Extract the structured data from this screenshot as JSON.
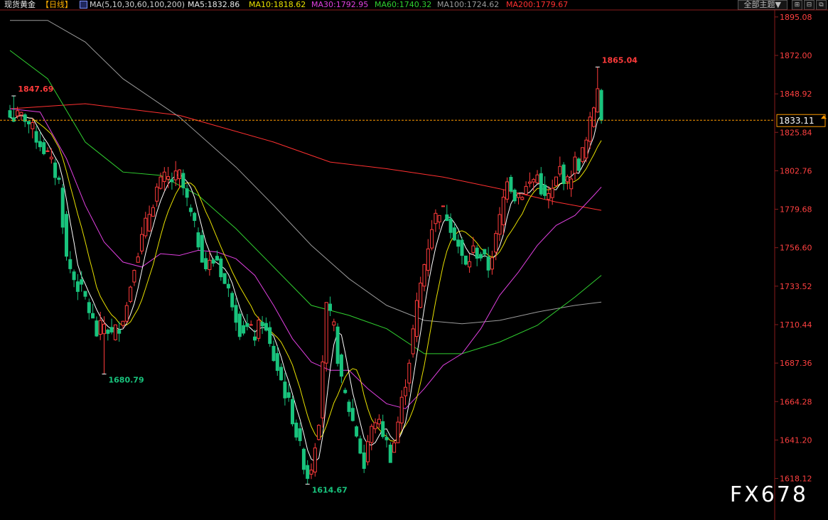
{
  "header": {
    "instrument": "现货黄金",
    "period": "【日线】",
    "ma_params": "MA(5,10,30,60,100,200)",
    "ma5": "MA5:1832.86",
    "ma10": "MA10:1818.62",
    "ma30": "MA30:1792.95",
    "ma60": "MA60:1740.32",
    "ma100": "MA100:1724.62",
    "ma200": "MA200:1779.67"
  },
  "toolbar": {
    "theme_label": "全部主题▼",
    "grid_icon": "⊞",
    "split_icon": "⊟",
    "window_icon": "⧉"
  },
  "watermark": "FX678",
  "colors": {
    "up": "#ff3b3b",
    "down": "#19c37d",
    "ma5": "#ffffff",
    "ma10": "#e8e000",
    "ma30": "#e040e0",
    "ma60": "#30d030",
    "ma100": "#9a9a9a",
    "ma200": "#ff3030",
    "axis_text": "#ff4040",
    "current_price": "#ff9a00"
  },
  "chart_data": {
    "type": "candlestick",
    "title": "",
    "y_ticks": [
      "1895.08",
      "1872.00",
      "1848.92",
      "1825.84",
      "1802.76",
      "1779.68",
      "1756.60",
      "1733.52",
      "1710.44",
      "1687.36",
      "1664.28",
      "1641.20",
      "1618.12"
    ],
    "ylim": [
      1603,
      1898
    ],
    "current_price": 1833.11,
    "current_price_label": "1833.11",
    "annotations": [
      {
        "label": "1847.69",
        "value": 1847.69,
        "kind": "high"
      },
      {
        "label": "1680.79",
        "value": 1680.79,
        "kind": "low"
      },
      {
        "label": "1614.67",
        "value": 1614.67,
        "kind": "low"
      },
      {
        "label": "1865.04",
        "value": 1865.04,
        "kind": "high"
      }
    ],
    "anchors": [
      [
        0,
        1835
      ],
      [
        4,
        1835
      ],
      [
        7,
        1823
      ],
      [
        10,
        1812
      ],
      [
        13,
        1796
      ],
      [
        15,
        1750
      ],
      [
        17,
        1738
      ],
      [
        20,
        1726
      ],
      [
        23,
        1705
      ],
      [
        25,
        1711
      ],
      [
        27,
        1704
      ],
      [
        29,
        1710
      ],
      [
        31,
        1722
      ],
      [
        33,
        1748
      ],
      [
        35,
        1762
      ],
      [
        37,
        1778
      ],
      [
        39,
        1792
      ],
      [
        41,
        1798
      ],
      [
        43,
        1797
      ],
      [
        45,
        1800
      ],
      [
        47,
        1784
      ],
      [
        49,
        1768
      ],
      [
        52,
        1745
      ],
      [
        55,
        1750
      ],
      [
        57,
        1735
      ],
      [
        59,
        1725
      ],
      [
        61,
        1708
      ],
      [
        63,
        1708
      ],
      [
        65,
        1704
      ],
      [
        67,
        1713
      ],
      [
        69,
        1697
      ],
      [
        71,
        1684
      ],
      [
        73,
        1670
      ],
      [
        75,
        1655
      ],
      [
        77,
        1636
      ],
      [
        79,
        1620
      ],
      [
        80,
        1626
      ],
      [
        82,
        1655
      ],
      [
        83,
        1690
      ],
      [
        84,
        1720
      ],
      [
        86,
        1708
      ],
      [
        88,
        1675
      ],
      [
        90,
        1660
      ],
      [
        92,
        1645
      ],
      [
        94,
        1625
      ],
      [
        95,
        1640
      ],
      [
        97,
        1654
      ],
      [
        99,
        1646
      ],
      [
        101,
        1632
      ],
      [
        102,
        1640
      ],
      [
        104,
        1664
      ],
      [
        106,
        1690
      ],
      [
        108,
        1722
      ],
      [
        110,
        1747
      ],
      [
        112,
        1770
      ],
      [
        114,
        1780
      ],
      [
        116,
        1776
      ],
      [
        118,
        1765
      ],
      [
        120,
        1750
      ],
      [
        121,
        1745
      ],
      [
        123,
        1755
      ],
      [
        125,
        1752
      ],
      [
        127,
        1745
      ],
      [
        129,
        1762
      ],
      [
        131,
        1786
      ],
      [
        132,
        1800
      ],
      [
        134,
        1788
      ],
      [
        136,
        1790
      ],
      [
        138,
        1795
      ],
      [
        140,
        1800
      ],
      [
        142,
        1785
      ],
      [
        144,
        1790
      ],
      [
        146,
        1804
      ],
      [
        148,
        1795
      ],
      [
        150,
        1808
      ],
      [
        151,
        1807
      ],
      [
        153,
        1820
      ],
      [
        155,
        1842
      ],
      [
        156,
        1848
      ],
      [
        157,
        1833
      ]
    ],
    "ma_lines": [
      {
        "name": "MA200",
        "values": [
          [
            0,
            1840
          ],
          [
            20,
            1843
          ],
          [
            45,
            1836
          ],
          [
            70,
            1820
          ],
          [
            85,
            1808
          ],
          [
            100,
            1804
          ],
          [
            115,
            1799
          ],
          [
            130,
            1792
          ],
          [
            145,
            1784
          ],
          [
            157,
            1779
          ]
        ]
      },
      {
        "name": "MA100",
        "values": [
          [
            0,
            1893
          ],
          [
            10,
            1893
          ],
          [
            20,
            1880
          ],
          [
            30,
            1858
          ],
          [
            45,
            1835
          ],
          [
            60,
            1805
          ],
          [
            70,
            1782
          ],
          [
            80,
            1758
          ],
          [
            90,
            1738
          ],
          [
            100,
            1722
          ],
          [
            110,
            1713
          ],
          [
            120,
            1711
          ],
          [
            130,
            1713
          ],
          [
            140,
            1718
          ],
          [
            150,
            1722
          ],
          [
            157,
            1724
          ]
        ]
      },
      {
        "name": "MA60",
        "values": [
          [
            0,
            1875
          ],
          [
            10,
            1858
          ],
          [
            20,
            1820
          ],
          [
            30,
            1802
          ],
          [
            40,
            1800
          ],
          [
            50,
            1788
          ],
          [
            60,
            1768
          ],
          [
            70,
            1745
          ],
          [
            80,
            1722
          ],
          [
            90,
            1716
          ],
          [
            100,
            1708
          ],
          [
            110,
            1693
          ],
          [
            120,
            1693
          ],
          [
            130,
            1700
          ],
          [
            140,
            1710
          ],
          [
            150,
            1727
          ],
          [
            157,
            1740
          ]
        ]
      },
      {
        "name": "MA30",
        "values": [
          [
            0,
            1840
          ],
          [
            8,
            1838
          ],
          [
            15,
            1810
          ],
          [
            20,
            1782
          ],
          [
            25,
            1760
          ],
          [
            30,
            1748
          ],
          [
            35,
            1745
          ],
          [
            40,
            1753
          ],
          [
            45,
            1752
          ],
          [
            50,
            1755
          ],
          [
            55,
            1754
          ],
          [
            60,
            1750
          ],
          [
            65,
            1740
          ],
          [
            70,
            1722
          ],
          [
            75,
            1702
          ],
          [
            80,
            1688
          ],
          [
            85,
            1683
          ],
          [
            90,
            1683
          ],
          [
            95,
            1672
          ],
          [
            100,
            1663
          ],
          [
            105,
            1660
          ],
          [
            110,
            1672
          ],
          [
            115,
            1686
          ],
          [
            120,
            1693
          ],
          [
            125,
            1708
          ],
          [
            130,
            1728
          ],
          [
            135,
            1742
          ],
          [
            140,
            1758
          ],
          [
            145,
            1770
          ],
          [
            150,
            1776
          ],
          [
            155,
            1788
          ],
          [
            157,
            1793
          ]
        ]
      }
    ]
  }
}
